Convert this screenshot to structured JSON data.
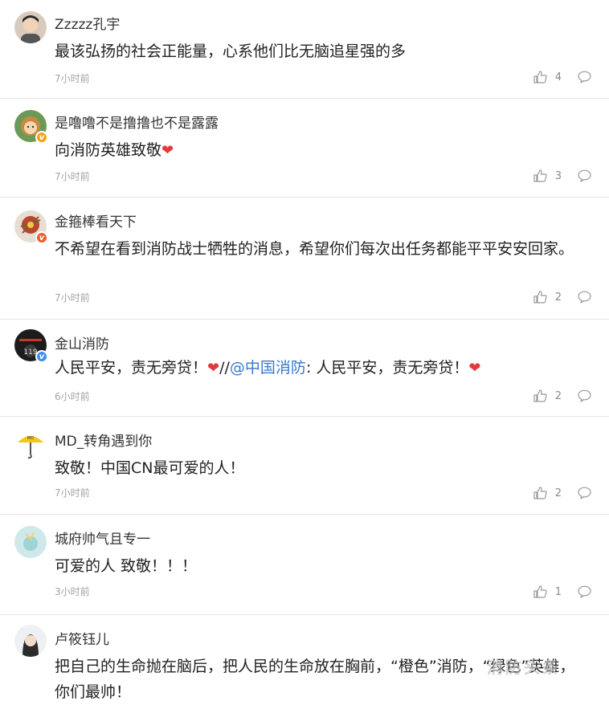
{
  "comments": [
    {
      "user": "Zzzzz孔宇",
      "text": "最该弘扬的社会正能量，心系他们比无脑追星强的多",
      "time": "7小时前",
      "likes": "4"
    },
    {
      "user": "是噜噜不是撸撸也不是露露",
      "text": "向消防英雄致敬",
      "time": "7小时前",
      "likes": "3"
    },
    {
      "user": "金箍棒看天下",
      "text": "不希望在看到消防战士牺牲的消息，希望你们每次出任务都能平平安安回家。",
      "time": "7小时前",
      "likes": "2"
    },
    {
      "user": "金山消防",
      "text_a": "人民平安，责无旁贷！",
      "sep": "//",
      "mention": "@中国消防",
      "text_b": ": 人民平安，责无旁贷！",
      "time": "6小时前",
      "likes": "2"
    },
    {
      "user": "MD_转角遇到你",
      "text": "致敬！中国CN最可爱的人！",
      "time": "7小时前",
      "likes": "2"
    },
    {
      "user": "城府帅气且专一",
      "text": "可爱的人 致敬！！！",
      "time": "3小时前",
      "likes": "1"
    },
    {
      "user": "卢筱钰儿",
      "text": "把自己的生命抛在脑后，把人民的生命放在胸前，“橙色”消防，“绿色”英雄，你们最帅！"
    }
  ],
  "watermark": "消防头条",
  "icons": {
    "like": "thumbs-up-icon",
    "reply": "comment-bubble-icon",
    "heart": "heart-icon",
    "verified": "verified-v-icon"
  },
  "colors": {
    "mention": "#3a79c9",
    "heart": "#e4393c",
    "time": "#a3a3a3"
  }
}
